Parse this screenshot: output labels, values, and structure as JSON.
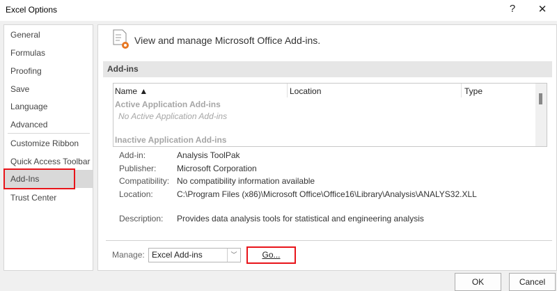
{
  "window": {
    "title": "Excel Options",
    "help": "?",
    "close": "✕"
  },
  "sidebar": {
    "items": [
      "General",
      "Formulas",
      "Proofing",
      "Save",
      "Language",
      "Advanced",
      "Customize Ribbon",
      "Quick Access Toolbar",
      "Add-Ins",
      "Trust Center"
    ],
    "selected": "Add-Ins"
  },
  "main": {
    "heading": "View and manage Microsoft Office Add-ins.",
    "section": "Add-ins",
    "table": {
      "columns": [
        "Name ▲",
        "Location",
        "Type"
      ],
      "groups": [
        {
          "label": "Active Application Add-ins",
          "empty": "No Active Application Add-ins"
        },
        {
          "label": "Inactive Application Add-ins"
        }
      ]
    },
    "details": [
      {
        "label": "Add-in:",
        "value": "Analysis ToolPak"
      },
      {
        "label": "Publisher:",
        "value": "Microsoft Corporation"
      },
      {
        "label": "Compatibility:",
        "value": "No compatibility information available"
      },
      {
        "label": "Location:",
        "value": "C:\\Program Files (x86)\\Microsoft Office\\Office16\\Library\\Analysis\\ANALYS32.XLL"
      },
      {
        "label": "Description:",
        "value": "Provides data analysis tools for statistical and engineering analysis"
      }
    ],
    "manage_label": "Manage:",
    "manage_value": "Excel Add-ins",
    "go": "Go..."
  },
  "footer": {
    "ok": "OK",
    "cancel": "Cancel"
  }
}
